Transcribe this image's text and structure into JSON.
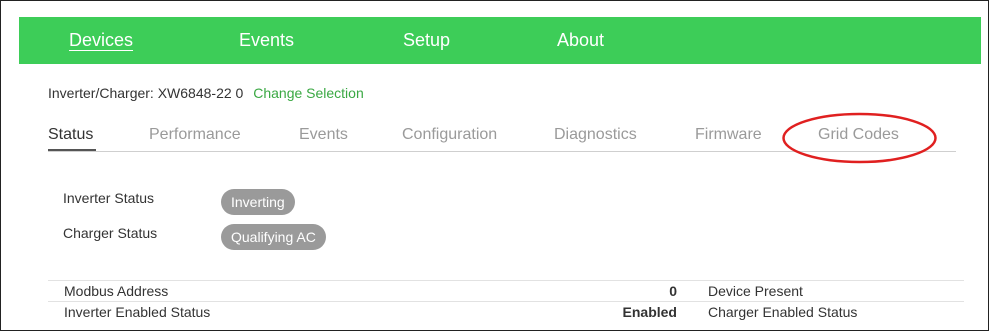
{
  "nav": {
    "items": [
      {
        "label": "Devices",
        "active": true
      },
      {
        "label": "Events",
        "active": false
      },
      {
        "label": "Setup",
        "active": false
      },
      {
        "label": "About",
        "active": false
      }
    ],
    "bar_color": "#3dcd58"
  },
  "selection": {
    "device_text": "Inverter/Charger: XW6848-22 0",
    "change_link": "Change Selection"
  },
  "tabs": [
    {
      "label": "Status",
      "active": true
    },
    {
      "label": "Performance",
      "active": false
    },
    {
      "label": "Events",
      "active": false
    },
    {
      "label": "Configuration",
      "active": false
    },
    {
      "label": "Diagnostics",
      "active": false
    },
    {
      "label": "Firmware",
      "active": false
    },
    {
      "label": "Grid Codes",
      "active": false,
      "highlighted": true
    }
  ],
  "annotation": {
    "shape": "ellipse",
    "color": "#e02020",
    "target": "Grid Codes"
  },
  "status": {
    "inverter": {
      "label": "Inverter Status",
      "value": "Inverting"
    },
    "charger": {
      "label": "Charger Status",
      "value": "Qualifying AC"
    }
  },
  "table": {
    "rows": [
      {
        "label": "Modbus Address",
        "value": "0",
        "label2": "Device Present"
      },
      {
        "label": "Inverter Enabled Status",
        "value": "Enabled",
        "label2": "Charger Enabled Status"
      }
    ]
  }
}
